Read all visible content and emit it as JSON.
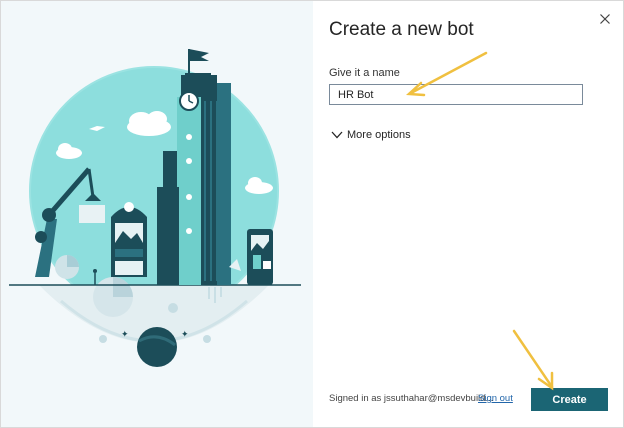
{
  "dialog": {
    "title": "Create a new bot",
    "close_icon": "close-icon",
    "name_field": {
      "label": "Give it a name",
      "value": "HR Bot",
      "placeholder": ""
    },
    "more_options": {
      "label": "More options",
      "icon": "chevron-down-icon"
    },
    "footer": {
      "signed_in_text": "Signed in as jssuthahar@msdevbuild...",
      "sign_out_label": "Sign out",
      "create_label": "Create"
    }
  },
  "illustration": {
    "icon": "city-illustration"
  },
  "annotations": {
    "arrow_color": "#f0c040"
  },
  "colors": {
    "accent": "#1b6574",
    "teal_light": "#7fd6d3",
    "teal_dark": "#1c4d59",
    "panel_bg": "#f2f8fa"
  }
}
